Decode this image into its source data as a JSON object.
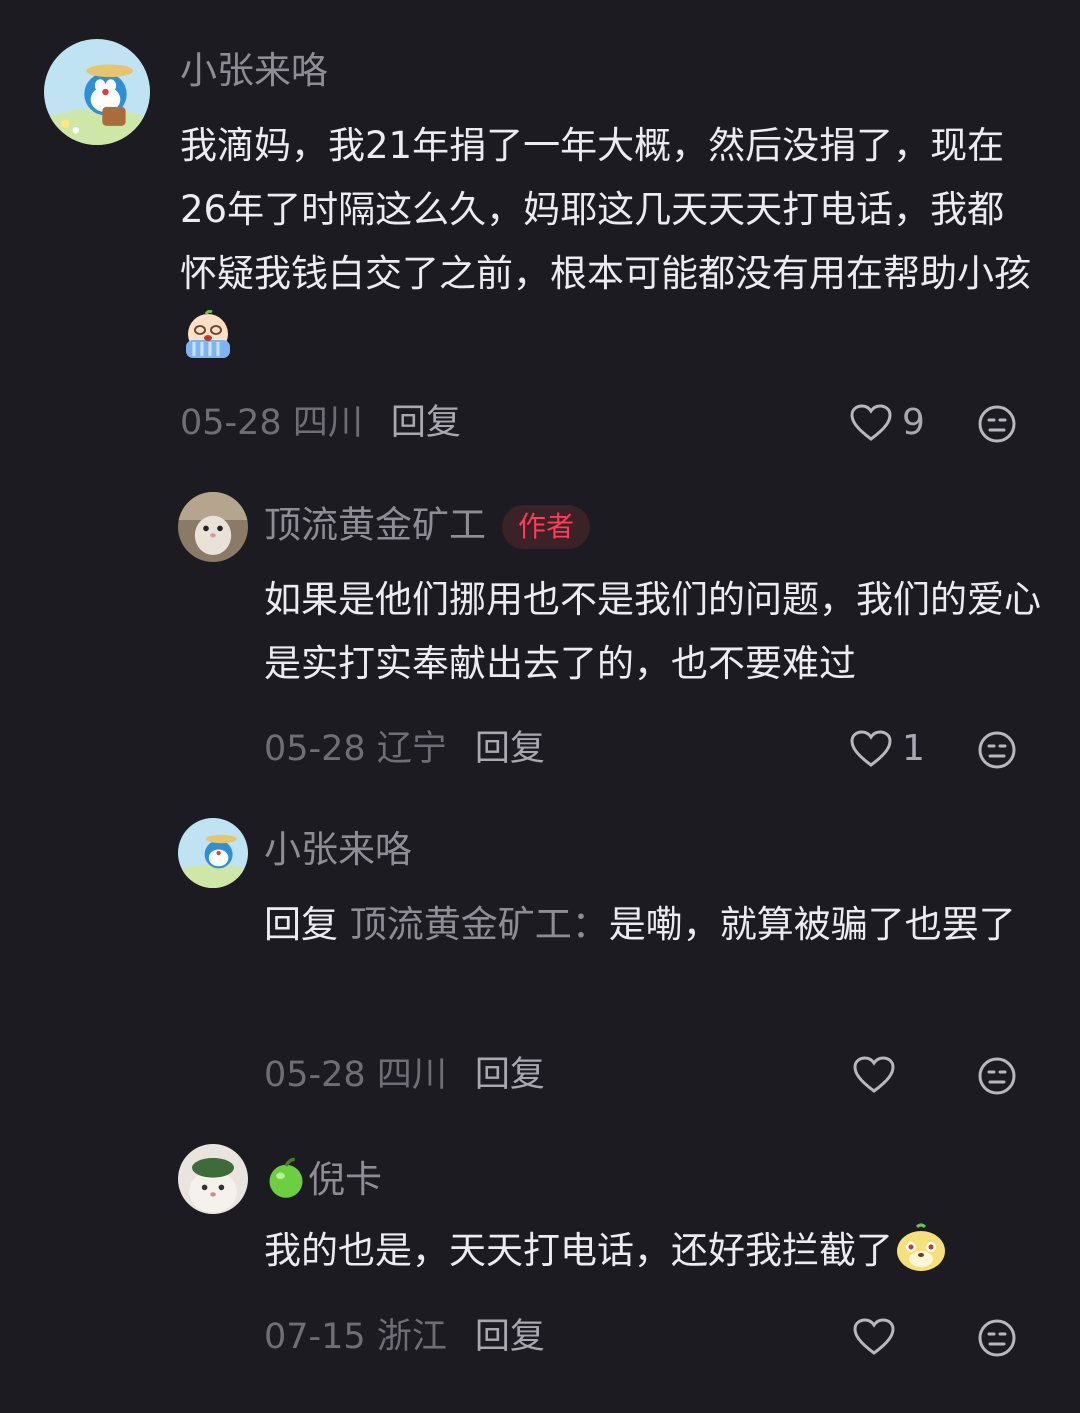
{
  "comments": [
    {
      "user": "小张来咯",
      "text": "我滴妈，我21年捐了一年大概，然后没捐了，现在26年了时隔这么久，妈耶这几天天天打电话，我都怀疑我钱白交了之前，根本可能都没有用在帮助小孩",
      "date_location": "05-28 四川",
      "reply_label": "回复",
      "likes": "9",
      "avatar_icon": "doraemon-avatar",
      "inline_emoji": "crying-face-emoji"
    },
    {
      "user": "顶流黄金矿工",
      "badge": "作者",
      "text": "如果是他们挪用也不是我们的问题，我们的爱心是实打实奉献出去了的，也不要难过",
      "date_location": "05-28 辽宁",
      "reply_label": "回复",
      "likes": "1",
      "avatar_icon": "hamster-avatar"
    },
    {
      "user": "小张来咯",
      "reply_prefix": "回复",
      "reply_target": "顶流黄金矿工：",
      "text": "是嘞，就算被骗了也罢了",
      "date_location": "05-28 四川",
      "reply_label": "回复",
      "likes": "",
      "avatar_icon": "doraemon-avatar"
    },
    {
      "user": "倪卡",
      "user_emoji": "apple-icon",
      "text": "我的也是，天天打电话，还好我拦截了",
      "date_location": "07-15 浙江",
      "reply_label": "回复",
      "likes": "",
      "avatar_icon": "cat-avatar",
      "inline_emoji": "smiling-dog-emoji"
    }
  ],
  "colors": {
    "background": "#1c1b22",
    "username": "#8e8d96",
    "body_text": "#ececf0",
    "author_badge": "#ff3b56"
  }
}
